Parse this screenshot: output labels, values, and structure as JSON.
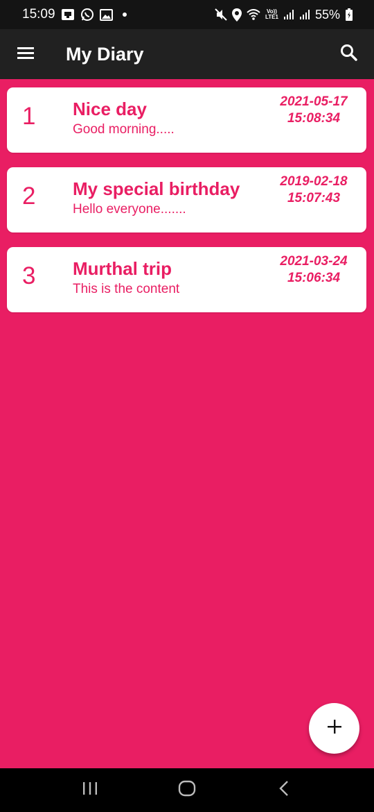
{
  "status_bar": {
    "time": "15:09",
    "battery": "55%",
    "volte_top": "Vo))",
    "volte_bottom": "LTE1",
    "icons": [
      "screen-cast-icon",
      "whatsapp-icon",
      "gallery-icon",
      "notification-dot-icon",
      "mute-icon",
      "location-icon",
      "wifi-icon",
      "signal-icon",
      "signal-icon-2",
      "battery-icon"
    ]
  },
  "app_bar": {
    "title": "My Diary",
    "menu_icon": "hamburger-menu-icon",
    "search_icon": "search-icon"
  },
  "entries": [
    {
      "number": "1",
      "title": "Nice day",
      "preview": "Good morning.....",
      "date": "2021-05-17",
      "time": "15:08:34"
    },
    {
      "number": "2",
      "title": "My special birthday",
      "preview": "Hello everyone.......",
      "date": "2019-02-18",
      "time": "15:07:43"
    },
    {
      "number": "3",
      "title": "Murthal trip",
      "preview": "This is the content",
      "date": "2021-03-24",
      "time": "15:06:34"
    }
  ],
  "fab": {
    "icon": "plus-icon",
    "label": "+"
  },
  "nav_bar": {
    "icons": [
      "recent-apps-icon",
      "home-icon",
      "back-icon"
    ]
  },
  "colors": {
    "accent": "#e91e63",
    "app_bar": "#212121",
    "status_bar": "#141414",
    "card": "#ffffff"
  }
}
